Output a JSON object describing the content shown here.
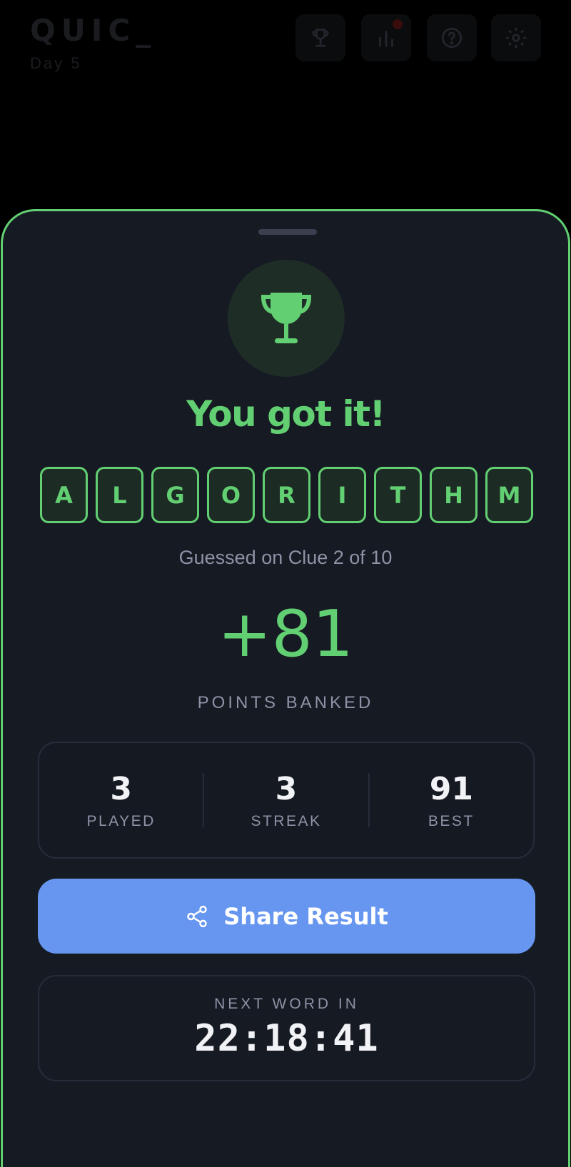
{
  "app": {
    "logo": "QUIC_",
    "day": "Day 5"
  },
  "header": {
    "icons": [
      "trophy-icon",
      "stats-icon",
      "help-icon",
      "settings-icon"
    ],
    "notification_dot_color": "#3a0d0d"
  },
  "result": {
    "headline": "You got it!",
    "letters": [
      "A",
      "L",
      "G",
      "O",
      "R",
      "I",
      "T",
      "H",
      "M"
    ],
    "guessed_text": "Guessed on Clue 2 of 10",
    "points": "+81",
    "points_label": "POINTS BANKED"
  },
  "stats": [
    {
      "value": "3",
      "label": "PLAYED"
    },
    {
      "value": "3",
      "label": "STREAK"
    },
    {
      "value": "91",
      "label": "BEST"
    }
  ],
  "share": {
    "label": "Share Result",
    "icon": "share-icon"
  },
  "next": {
    "label": "NEXT WORD IN",
    "countdown": "22:18:41"
  },
  "colors": {
    "accent_green": "#62d072",
    "share_blue": "#6796f0",
    "sheet_bg": "#161a23",
    "muted_text": "#8c93a6"
  }
}
